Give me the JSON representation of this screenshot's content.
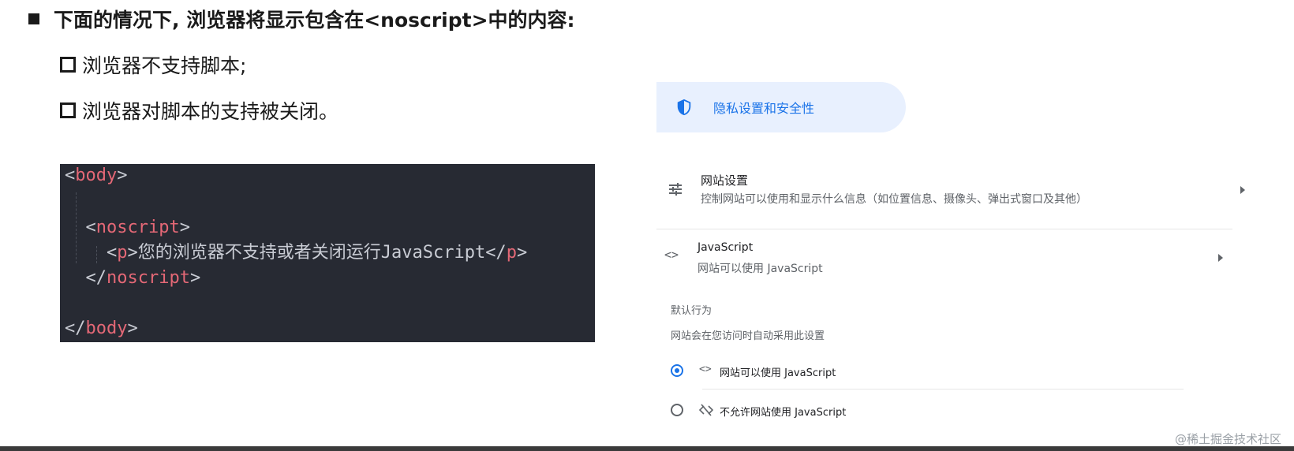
{
  "slide": {
    "heading": "下面的情况下, 浏览器将显示包含在<noscript>中的内容:",
    "bullets": [
      "浏览器不支持脚本;",
      "浏览器对脚本的支持被关闭。"
    ]
  },
  "code": {
    "open_body": "body",
    "noscript": "noscript",
    "p": "p",
    "p_text": "您的浏览器不支持或者关闭运行JavaScript",
    "close_body": "body"
  },
  "settings": {
    "privacy_label": "隐私设置和安全性",
    "site_settings_title": "网站设置",
    "site_settings_sub": "控制网站可以使用和显示什么信息（如位置信息、摄像头、弹出式窗口及其他）",
    "js_title": "JavaScript",
    "js_sub": "网站可以使用 JavaScript",
    "default_behavior": "默认行为",
    "default_desc": "网站会在您访问时自动采用此设置",
    "option_allow": "网站可以使用 JavaScript",
    "option_block": "不允许网站使用 JavaScript",
    "selected_option": "allow"
  },
  "watermark": "@稀土掘金技术社区",
  "colors": {
    "accent": "#1a73e8",
    "code_bg": "#272a33",
    "tag_name": "#e46876",
    "pill_bg": "#e8f0fe"
  }
}
